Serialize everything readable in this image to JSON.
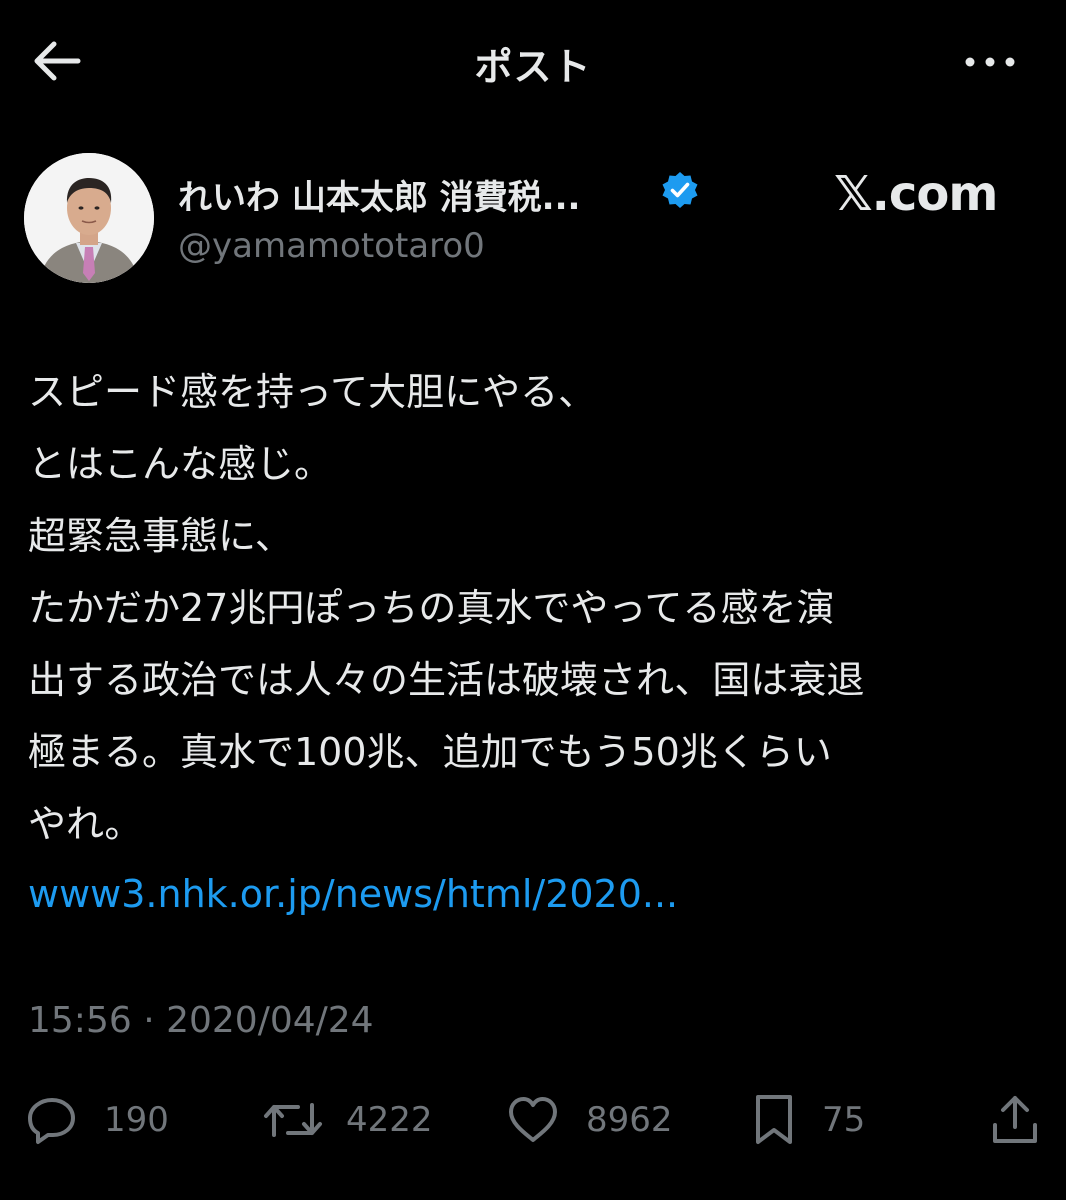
{
  "header": {
    "title": "ポスト"
  },
  "author": {
    "name": "れいわ 山本太郎 消費税...",
    "handle": "@yamamototaro0"
  },
  "watermark": "𝕏.com",
  "post": {
    "lines": [
      "スピード感を持って大胆にやる、",
      "とはこんな感じ。",
      "超緊急事態に、",
      "たかだか27兆円ぽっちの真水でやってる感を演",
      "出する政治では人々の生活は破壊され、国は衰退",
      "極まる。真水で100兆、追加でもう50兆くらい",
      "やれ。"
    ],
    "link": "www3.nhk.or.jp/news/html/2020...",
    "timestamp": "15:56 · 2020/04/24"
  },
  "actions": {
    "replies": "190",
    "reposts": "4222",
    "likes": "8962",
    "bookmarks": "75"
  },
  "colors": {
    "background": "#000000",
    "text": "#e7e9ea",
    "muted": "#71767b",
    "link": "#1d9bf0",
    "verified": "#1d9bf0"
  },
  "icons": [
    "back-arrow-icon",
    "more-icon",
    "verified-badge-icon",
    "reply-icon",
    "repost-icon",
    "like-icon",
    "bookmark-icon",
    "share-icon"
  ]
}
